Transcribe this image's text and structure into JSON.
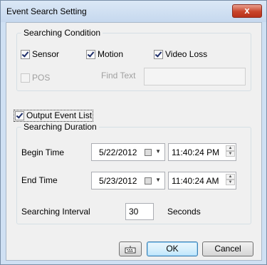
{
  "window": {
    "title": "Event Search Setting",
    "close_label": "x"
  },
  "searching_condition": {
    "legend": "Searching Condition",
    "sensor": {
      "label": "Sensor",
      "checked": true
    },
    "motion": {
      "label": "Motion",
      "checked": true
    },
    "video_loss": {
      "label": "Video Loss",
      "checked": true
    },
    "pos": {
      "label": "POS",
      "checked": false,
      "enabled": false
    },
    "find_text": {
      "label": "Find Text",
      "value": ""
    }
  },
  "output_event_list": {
    "label": "Output Event List",
    "checked": true
  },
  "searching_duration": {
    "legend": "Searching Duration",
    "begin": {
      "label": "Begin Time",
      "date": "5/22/2012",
      "time": "11:40:24 PM"
    },
    "end": {
      "label": "End Time",
      "date": "5/23/2012",
      "time": "11:40:24 AM"
    },
    "interval": {
      "label": "Searching Interval",
      "value": "30",
      "unit": "Seconds"
    }
  },
  "buttons": {
    "ok": "OK",
    "cancel": "Cancel"
  }
}
